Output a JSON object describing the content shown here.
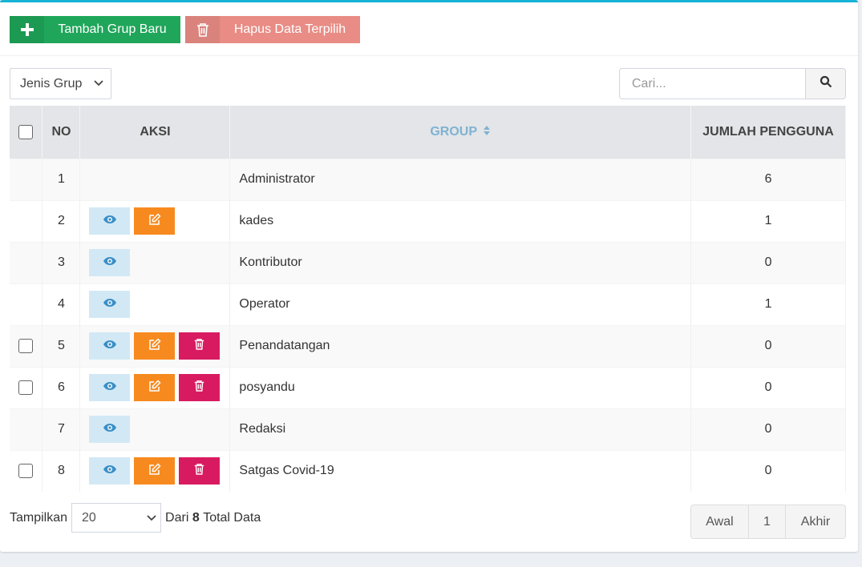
{
  "toolbar": {
    "add_label": "Tambah Grup Baru",
    "delete_label": "Hapus Data Terpilih"
  },
  "filter": {
    "jenis_grup": "Jenis Grup"
  },
  "search": {
    "placeholder": "Cari..."
  },
  "table": {
    "headers": {
      "no": "NO",
      "aksi": "AKSI",
      "group": "GROUP",
      "jumlah": "JUMLAH PENGGUNA"
    },
    "rows": [
      {
        "no": "1",
        "group": "Administrator",
        "jumlah": "6",
        "checkbox": false,
        "actions": []
      },
      {
        "no": "2",
        "group": "kades",
        "jumlah": "1",
        "checkbox": false,
        "actions": [
          "view",
          "edit"
        ]
      },
      {
        "no": "3",
        "group": "Kontributor",
        "jumlah": "0",
        "checkbox": false,
        "actions": [
          "view"
        ]
      },
      {
        "no": "4",
        "group": "Operator",
        "jumlah": "1",
        "checkbox": false,
        "actions": [
          "view"
        ]
      },
      {
        "no": "5",
        "group": "Penandatangan",
        "jumlah": "0",
        "checkbox": true,
        "actions": [
          "view",
          "edit",
          "delete"
        ]
      },
      {
        "no": "6",
        "group": "posyandu",
        "jumlah": "0",
        "checkbox": true,
        "actions": [
          "view",
          "edit",
          "delete"
        ]
      },
      {
        "no": "7",
        "group": "Redaksi",
        "jumlah": "0",
        "checkbox": false,
        "actions": [
          "view"
        ]
      },
      {
        "no": "8",
        "group": "Satgas Covid-19",
        "jumlah": "0",
        "checkbox": true,
        "actions": [
          "view",
          "edit",
          "delete"
        ]
      }
    ]
  },
  "footer": {
    "show_label": "Tampilkan",
    "page_size": "20",
    "from_label": "Dari",
    "total": "8",
    "total_label": "Total Data"
  },
  "pagination": {
    "first": "Awal",
    "page": "1",
    "last": "Akhir"
  },
  "colors": {
    "accent_top": "#16b3d6",
    "add_button": "#1fa65a",
    "delete_button": "#e88c85",
    "view": "#d2e9f5",
    "edit": "#f78a1f",
    "delete": "#d81b60"
  },
  "icons": {
    "add": "plus-icon",
    "delete": "trash-icon",
    "search": "search-icon",
    "view": "eye-icon",
    "edit": "edit-icon",
    "sort": "sort-icon"
  }
}
